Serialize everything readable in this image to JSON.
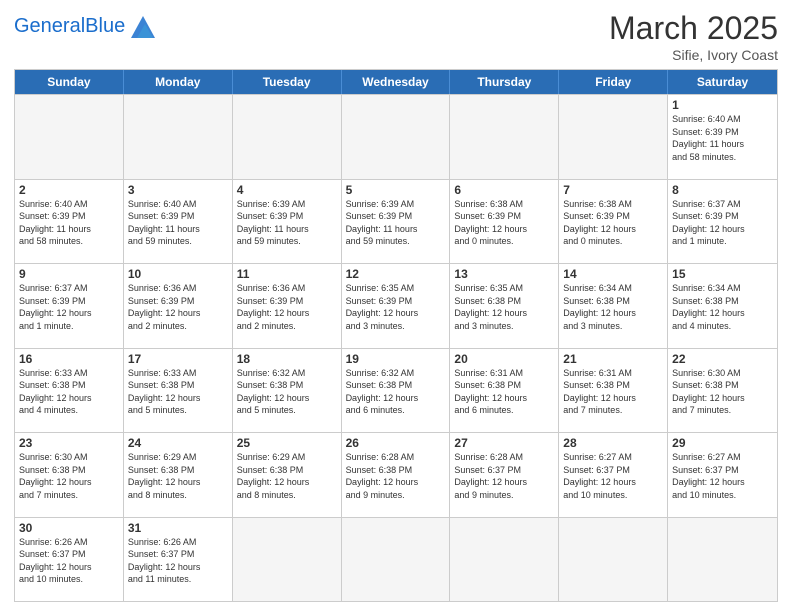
{
  "header": {
    "logo_general": "General",
    "logo_blue": "Blue",
    "month_title": "March 2025",
    "subtitle": "Sifie, Ivory Coast"
  },
  "days_of_week": [
    "Sunday",
    "Monday",
    "Tuesday",
    "Wednesday",
    "Thursday",
    "Friday",
    "Saturday"
  ],
  "rows": [
    {
      "cells": [
        {
          "day": "",
          "empty": true
        },
        {
          "day": "",
          "empty": true
        },
        {
          "day": "",
          "empty": true
        },
        {
          "day": "",
          "empty": true
        },
        {
          "day": "",
          "empty": true
        },
        {
          "day": "",
          "empty": true
        },
        {
          "day": "1",
          "empty": false,
          "info": "Sunrise: 6:40 AM\nSunset: 6:39 PM\nDaylight: 11 hours\nand 58 minutes."
        }
      ]
    },
    {
      "cells": [
        {
          "day": "2",
          "empty": false,
          "info": "Sunrise: 6:40 AM\nSunset: 6:39 PM\nDaylight: 11 hours\nand 58 minutes."
        },
        {
          "day": "3",
          "empty": false,
          "info": "Sunrise: 6:40 AM\nSunset: 6:39 PM\nDaylight: 11 hours\nand 59 minutes."
        },
        {
          "day": "4",
          "empty": false,
          "info": "Sunrise: 6:39 AM\nSunset: 6:39 PM\nDaylight: 11 hours\nand 59 minutes."
        },
        {
          "day": "5",
          "empty": false,
          "info": "Sunrise: 6:39 AM\nSunset: 6:39 PM\nDaylight: 11 hours\nand 59 minutes."
        },
        {
          "day": "6",
          "empty": false,
          "info": "Sunrise: 6:38 AM\nSunset: 6:39 PM\nDaylight: 12 hours\nand 0 minutes."
        },
        {
          "day": "7",
          "empty": false,
          "info": "Sunrise: 6:38 AM\nSunset: 6:39 PM\nDaylight: 12 hours\nand 0 minutes."
        },
        {
          "day": "8",
          "empty": false,
          "info": "Sunrise: 6:37 AM\nSunset: 6:39 PM\nDaylight: 12 hours\nand 1 minute."
        }
      ]
    },
    {
      "cells": [
        {
          "day": "9",
          "empty": false,
          "info": "Sunrise: 6:37 AM\nSunset: 6:39 PM\nDaylight: 12 hours\nand 1 minute."
        },
        {
          "day": "10",
          "empty": false,
          "info": "Sunrise: 6:36 AM\nSunset: 6:39 PM\nDaylight: 12 hours\nand 2 minutes."
        },
        {
          "day": "11",
          "empty": false,
          "info": "Sunrise: 6:36 AM\nSunset: 6:39 PM\nDaylight: 12 hours\nand 2 minutes."
        },
        {
          "day": "12",
          "empty": false,
          "info": "Sunrise: 6:35 AM\nSunset: 6:39 PM\nDaylight: 12 hours\nand 3 minutes."
        },
        {
          "day": "13",
          "empty": false,
          "info": "Sunrise: 6:35 AM\nSunset: 6:38 PM\nDaylight: 12 hours\nand 3 minutes."
        },
        {
          "day": "14",
          "empty": false,
          "info": "Sunrise: 6:34 AM\nSunset: 6:38 PM\nDaylight: 12 hours\nand 3 minutes."
        },
        {
          "day": "15",
          "empty": false,
          "info": "Sunrise: 6:34 AM\nSunset: 6:38 PM\nDaylight: 12 hours\nand 4 minutes."
        }
      ]
    },
    {
      "cells": [
        {
          "day": "16",
          "empty": false,
          "info": "Sunrise: 6:33 AM\nSunset: 6:38 PM\nDaylight: 12 hours\nand 4 minutes."
        },
        {
          "day": "17",
          "empty": false,
          "info": "Sunrise: 6:33 AM\nSunset: 6:38 PM\nDaylight: 12 hours\nand 5 minutes."
        },
        {
          "day": "18",
          "empty": false,
          "info": "Sunrise: 6:32 AM\nSunset: 6:38 PM\nDaylight: 12 hours\nand 5 minutes."
        },
        {
          "day": "19",
          "empty": false,
          "info": "Sunrise: 6:32 AM\nSunset: 6:38 PM\nDaylight: 12 hours\nand 6 minutes."
        },
        {
          "day": "20",
          "empty": false,
          "info": "Sunrise: 6:31 AM\nSunset: 6:38 PM\nDaylight: 12 hours\nand 6 minutes."
        },
        {
          "day": "21",
          "empty": false,
          "info": "Sunrise: 6:31 AM\nSunset: 6:38 PM\nDaylight: 12 hours\nand 7 minutes."
        },
        {
          "day": "22",
          "empty": false,
          "info": "Sunrise: 6:30 AM\nSunset: 6:38 PM\nDaylight: 12 hours\nand 7 minutes."
        }
      ]
    },
    {
      "cells": [
        {
          "day": "23",
          "empty": false,
          "info": "Sunrise: 6:30 AM\nSunset: 6:38 PM\nDaylight: 12 hours\nand 7 minutes."
        },
        {
          "day": "24",
          "empty": false,
          "info": "Sunrise: 6:29 AM\nSunset: 6:38 PM\nDaylight: 12 hours\nand 8 minutes."
        },
        {
          "day": "25",
          "empty": false,
          "info": "Sunrise: 6:29 AM\nSunset: 6:38 PM\nDaylight: 12 hours\nand 8 minutes."
        },
        {
          "day": "26",
          "empty": false,
          "info": "Sunrise: 6:28 AM\nSunset: 6:38 PM\nDaylight: 12 hours\nand 9 minutes."
        },
        {
          "day": "27",
          "empty": false,
          "info": "Sunrise: 6:28 AM\nSunset: 6:37 PM\nDaylight: 12 hours\nand 9 minutes."
        },
        {
          "day": "28",
          "empty": false,
          "info": "Sunrise: 6:27 AM\nSunset: 6:37 PM\nDaylight: 12 hours\nand 10 minutes."
        },
        {
          "day": "29",
          "empty": false,
          "info": "Sunrise: 6:27 AM\nSunset: 6:37 PM\nDaylight: 12 hours\nand 10 minutes."
        }
      ]
    },
    {
      "cells": [
        {
          "day": "30",
          "empty": false,
          "info": "Sunrise: 6:26 AM\nSunset: 6:37 PM\nDaylight: 12 hours\nand 10 minutes."
        },
        {
          "day": "31",
          "empty": false,
          "info": "Sunrise: 6:26 AM\nSunset: 6:37 PM\nDaylight: 12 hours\nand 11 minutes."
        },
        {
          "day": "",
          "empty": true
        },
        {
          "day": "",
          "empty": true
        },
        {
          "day": "",
          "empty": true
        },
        {
          "day": "",
          "empty": true
        },
        {
          "day": "",
          "empty": true
        }
      ]
    }
  ]
}
